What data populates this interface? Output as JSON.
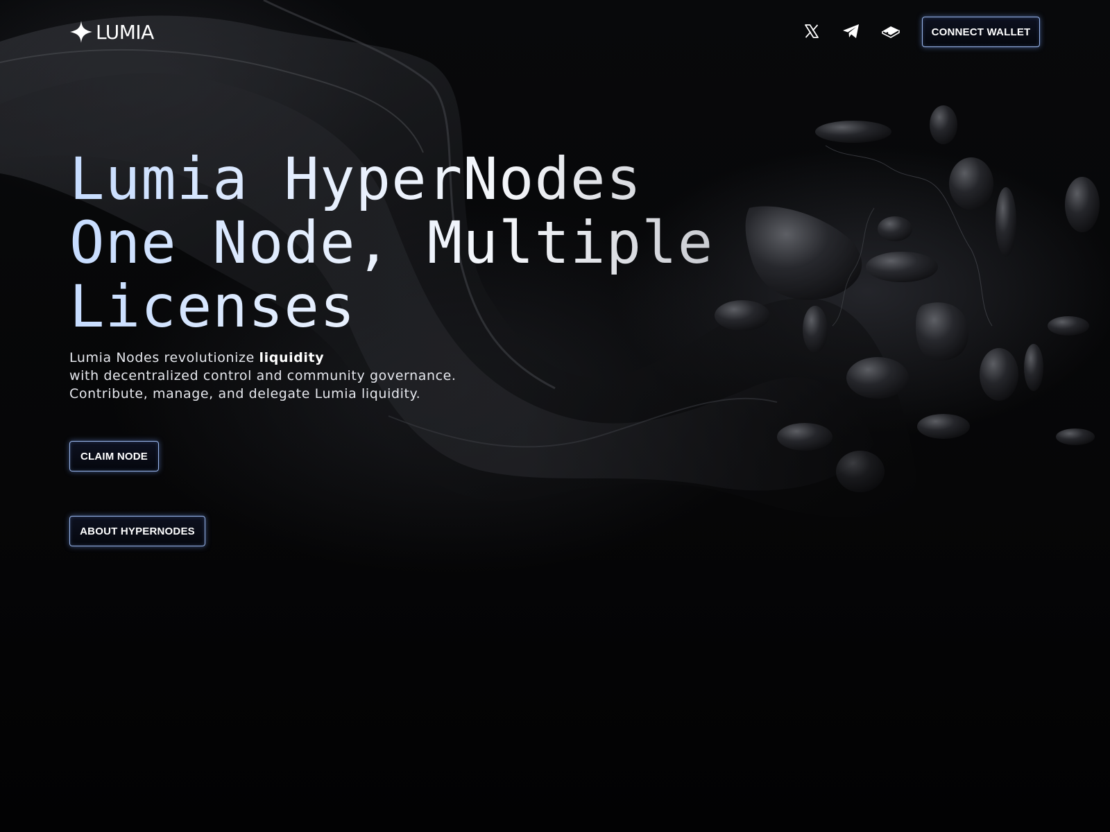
{
  "header": {
    "logo_text": "LUMIA",
    "social_icons": [
      "x-icon",
      "telegram-icon",
      "gitbook-icon"
    ],
    "connect_label": "CONNECT WALLET"
  },
  "hero": {
    "title_lines": [
      "Lumia HyperNodes",
      "One Node, Multiple",
      "Licenses"
    ],
    "desc_line1_prefix": "Lumia Nodes revolutionize ",
    "desc_line1_bold": "liquidity",
    "desc_line2": "with decentralized control and community governance.",
    "desc_line3": "Contribute, manage, and delegate Lumia liquidity."
  },
  "actions": {
    "claim_label": "CLAIM NODE",
    "about_label": "ABOUT HYPERNODES"
  },
  "colors": {
    "background": "#030304",
    "button_border": "#9bb8ee",
    "title_gradient_start": "#c6dcff",
    "title_gradient_end": "#c5c7cd"
  }
}
